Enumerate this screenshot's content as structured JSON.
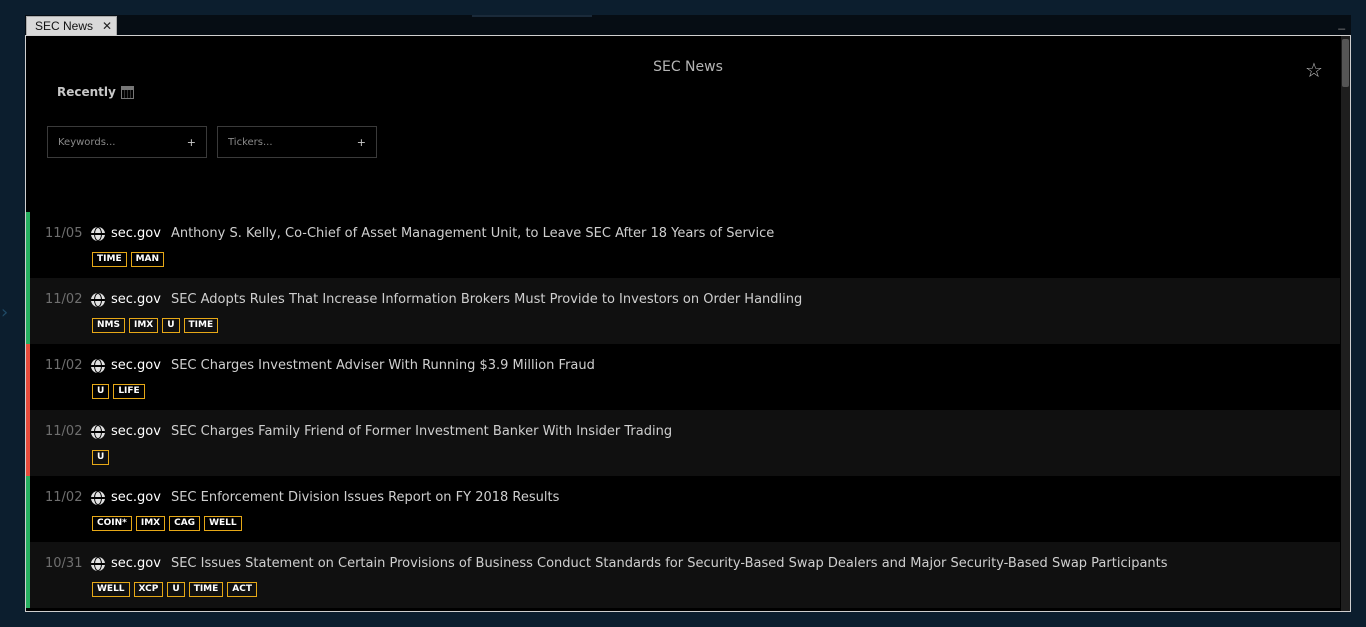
{
  "tab": {
    "label": "SEC News",
    "close": "✕"
  },
  "window": {
    "minimize": "_"
  },
  "panel": {
    "title": "SEC News",
    "recent_label": "Recently"
  },
  "filters": {
    "keywords": {
      "placeholder": "Keywords...",
      "add": "+"
    },
    "tickers": {
      "placeholder": "Tickers...",
      "add": "+"
    }
  },
  "colors": {
    "positive": "#27ae60",
    "negative": "#e74c3c",
    "tag_border": "#e6a817"
  },
  "news": [
    {
      "date": "11/05",
      "source": "sec.gov",
      "headline": "Anthony S. Kelly, Co-Chief of Asset Management Unit, to Leave SEC After 18 Years of Service",
      "sentiment": "positive",
      "tags": [
        "TIME",
        "MAN"
      ]
    },
    {
      "date": "11/02",
      "source": "sec.gov",
      "headline": "SEC Adopts Rules That Increase Information Brokers Must Provide to Investors on Order Handling",
      "sentiment": "positive",
      "tags": [
        "NMS",
        "IMX",
        "U",
        "TIME"
      ]
    },
    {
      "date": "11/02",
      "source": "sec.gov",
      "headline": "SEC Charges Investment Adviser With Running $3.9 Million Fraud",
      "sentiment": "negative",
      "tags": [
        "U",
        "LIFE"
      ]
    },
    {
      "date": "11/02",
      "source": "sec.gov",
      "headline": "SEC Charges Family Friend of Former Investment Banker With Insider Trading",
      "sentiment": "negative",
      "tags": [
        "U"
      ]
    },
    {
      "date": "11/02",
      "source": "sec.gov",
      "headline": "SEC Enforcement Division Issues Report on FY 2018 Results",
      "sentiment": "positive",
      "tags": [
        "COIN*",
        "IMX",
        "CAG",
        "WELL"
      ]
    },
    {
      "date": "10/31",
      "source": "sec.gov",
      "headline": "SEC Issues Statement on Certain Provisions of Business Conduct Standards for Security-Based Swap Dealers and Major Security-Based Swap Participants",
      "sentiment": "positive",
      "tags": [
        "WELL",
        "XCP",
        "U",
        "TIME",
        "ACT"
      ]
    }
  ]
}
